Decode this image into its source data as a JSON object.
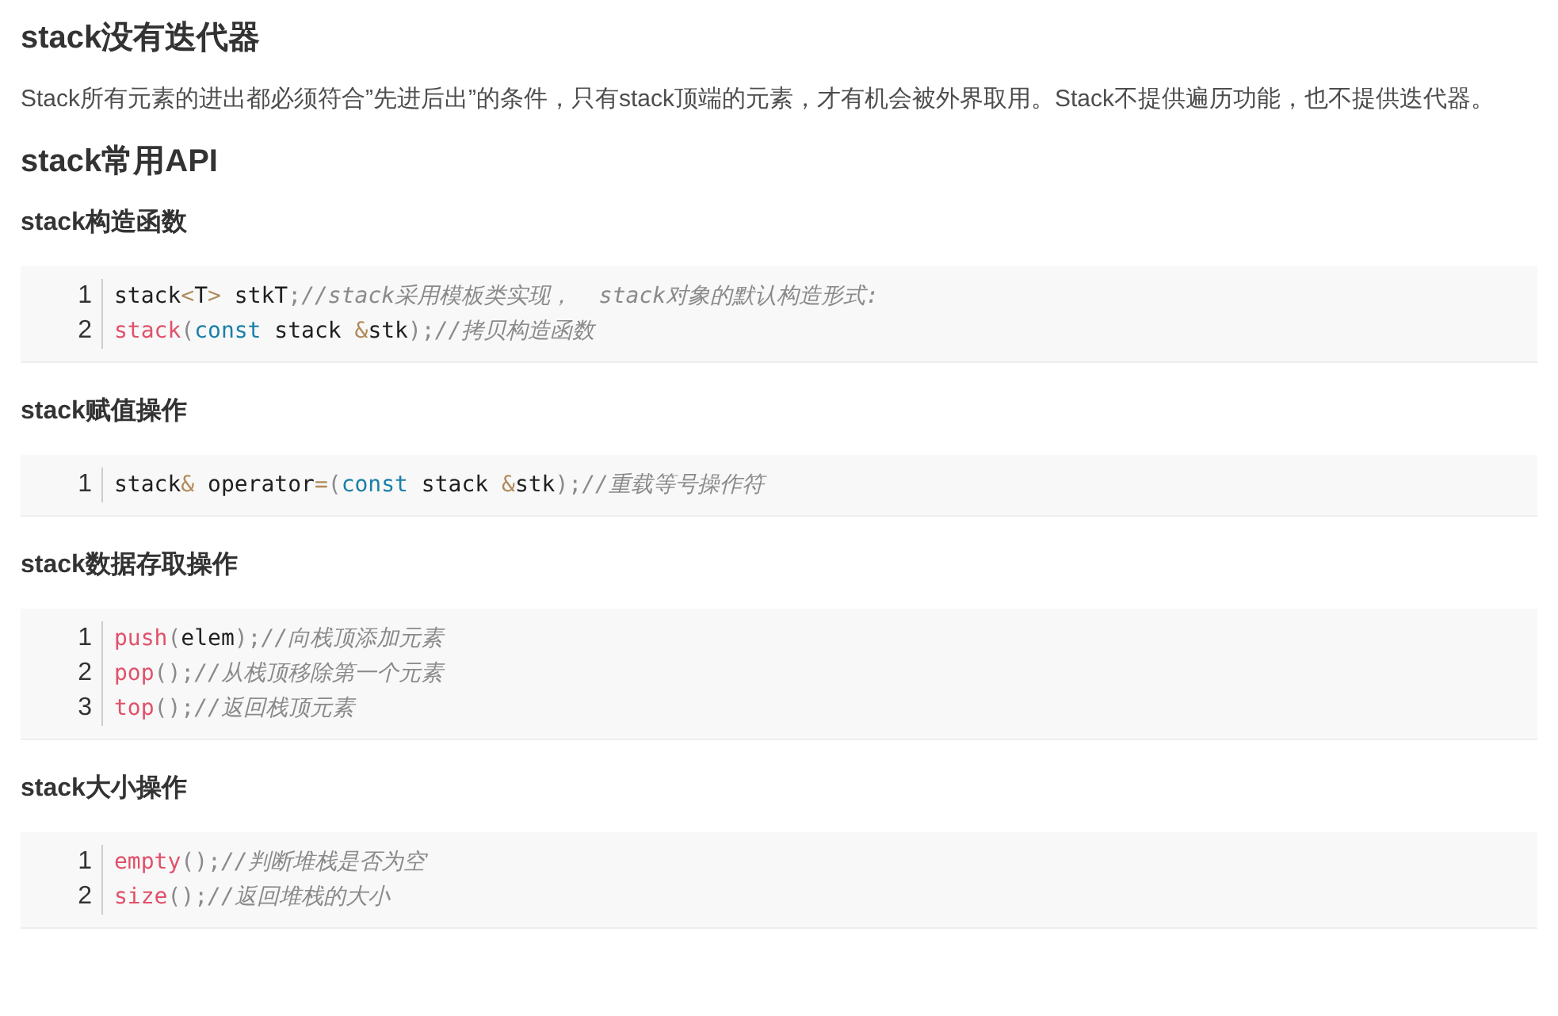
{
  "blocks": [
    {
      "kind": "h2",
      "text": "stack没有迭代器"
    },
    {
      "kind": "p",
      "text": "Stack所有元素的进出都必须符合”先进后出”的条件，只有stack顶端的元素，才有机会被外界取用。Stack不提供遍历功能，也不提供迭代器。"
    },
    {
      "kind": "h2",
      "text": "stack常用API"
    },
    {
      "kind": "h4",
      "text": "stack构造函数"
    },
    {
      "kind": "code",
      "lines": [
        {
          "number": "1",
          "tokens": [
            {
              "kind": "plain",
              "text": "stack"
            },
            {
              "kind": "op",
              "text": "<"
            },
            {
              "kind": "plain",
              "text": "T"
            },
            {
              "kind": "op",
              "text": ">"
            },
            {
              "kind": "plain",
              "text": " stkT"
            },
            {
              "kind": "punct",
              "text": ";"
            },
            {
              "kind": "comment",
              "text": "//stack采用模板类实现，  stack对象的默认构造形式:"
            }
          ]
        },
        {
          "number": "2",
          "tokens": [
            {
              "kind": "fn",
              "text": "stack"
            },
            {
              "kind": "punct",
              "text": "("
            },
            {
              "kind": "keyword",
              "text": "const"
            },
            {
              "kind": "plain",
              "text": " stack "
            },
            {
              "kind": "op",
              "text": "&"
            },
            {
              "kind": "plain",
              "text": "stk"
            },
            {
              "kind": "punct",
              "text": ");"
            },
            {
              "kind": "comment",
              "text": "//拷贝构造函数"
            }
          ]
        }
      ]
    },
    {
      "kind": "h4",
      "text": "stack赋值操作"
    },
    {
      "kind": "code",
      "lines": [
        {
          "number": "1",
          "tokens": [
            {
              "kind": "plain",
              "text": "stack"
            },
            {
              "kind": "op",
              "text": "&"
            },
            {
              "kind": "plain",
              "text": " operator"
            },
            {
              "kind": "op",
              "text": "="
            },
            {
              "kind": "punct",
              "text": "("
            },
            {
              "kind": "keyword",
              "text": "const"
            },
            {
              "kind": "plain",
              "text": " stack "
            },
            {
              "kind": "op",
              "text": "&"
            },
            {
              "kind": "plain",
              "text": "stk"
            },
            {
              "kind": "punct",
              "text": ");"
            },
            {
              "kind": "comment",
              "text": "//重载等号操作符"
            }
          ]
        }
      ]
    },
    {
      "kind": "h4",
      "text": "stack数据存取操作"
    },
    {
      "kind": "code",
      "lines": [
        {
          "number": "1",
          "tokens": [
            {
              "kind": "fn",
              "text": "push"
            },
            {
              "kind": "punct",
              "text": "("
            },
            {
              "kind": "plain",
              "text": "elem"
            },
            {
              "kind": "punct",
              "text": ");"
            },
            {
              "kind": "comment",
              "text": "//向栈顶添加元素"
            }
          ]
        },
        {
          "number": "2",
          "tokens": [
            {
              "kind": "fn",
              "text": "pop"
            },
            {
              "kind": "punct",
              "text": "();"
            },
            {
              "kind": "comment",
              "text": "//从栈顶移除第一个元素"
            }
          ]
        },
        {
          "number": "3",
          "tokens": [
            {
              "kind": "fn",
              "text": "top"
            },
            {
              "kind": "punct",
              "text": "();"
            },
            {
              "kind": "comment",
              "text": "//返回栈顶元素"
            }
          ]
        }
      ]
    },
    {
      "kind": "h4",
      "text": "stack大小操作"
    },
    {
      "kind": "code",
      "lines": [
        {
          "number": "1",
          "tokens": [
            {
              "kind": "fn",
              "text": "empty"
            },
            {
              "kind": "punct",
              "text": "();"
            },
            {
              "kind": "comment",
              "text": "//判断堆栈是否为空"
            }
          ]
        },
        {
          "number": "2",
          "tokens": [
            {
              "kind": "fn",
              "text": "size"
            },
            {
              "kind": "punct",
              "text": "();"
            },
            {
              "kind": "comment",
              "text": "//返回堆栈的大小"
            }
          ]
        }
      ]
    }
  ]
}
